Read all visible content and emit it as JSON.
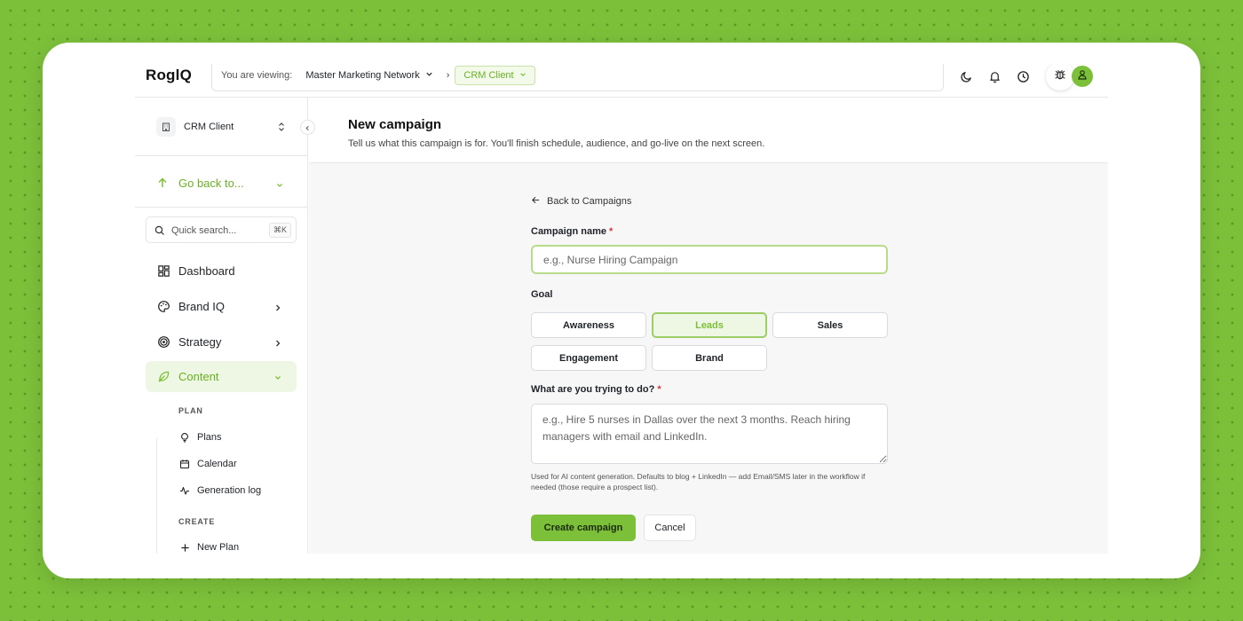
{
  "app": {
    "logo": "RoglQ",
    "viewing_label": "You are viewing:",
    "network": "Master Marketing Network",
    "breadcrumb_sep": "›",
    "client_pill": "CRM Client"
  },
  "header_icons": [
    "moon-icon",
    "bell-icon",
    "clock-icon",
    "bug-icon",
    "user-icon"
  ],
  "sidebar": {
    "client_name": "CRM Client",
    "go_back": "Go back to...",
    "search_placeholder": "Quick search...",
    "search_shortcut": "⌘K",
    "nav": [
      {
        "label": "Dashboard",
        "icon": "dashboard-icon"
      },
      {
        "label": "Brand IQ",
        "icon": "palette-icon"
      },
      {
        "label": "Strategy",
        "icon": "target-icon"
      },
      {
        "label": "Content",
        "icon": "leaf-icon"
      }
    ],
    "plan_label": "PLAN",
    "plan_items": [
      {
        "label": "Plans",
        "icon": "lightbulb-icon"
      },
      {
        "label": "Calendar",
        "icon": "calendar-icon"
      },
      {
        "label": "Generation log",
        "icon": "activity-icon"
      }
    ],
    "create_label": "CREATE",
    "create_items": [
      {
        "label": "New Plan",
        "icon": "plus-icon"
      }
    ]
  },
  "main": {
    "title": "New campaign",
    "subtitle": "Tell us what this campaign is for. You'll finish schedule, audience, and go-live on the next screen.",
    "back_link": "Back to Campaigns",
    "campaign_name_label": "Campaign name",
    "required_mark": "*",
    "campaign_name_placeholder": "e.g., Nurse Hiring Campaign",
    "campaign_name_value": "",
    "goal_label": "Goal",
    "goals": [
      "Awareness",
      "Leads",
      "Sales",
      "Engagement",
      "Brand"
    ],
    "selected_goal": "Leads",
    "objective_label": "What are you trying to do?",
    "objective_placeholder": "e.g., Hire 5 nurses in Dallas over the next 3 months. Reach hiring managers with email and LinkedIn.",
    "objective_value": "",
    "helper": "Used for AI content generation. Defaults to blog + LinkedIn — add Email/SMS later in the workflow if needed (those require a prospect list).",
    "create_button": "Create campaign",
    "cancel_button": "Cancel"
  },
  "colors": {
    "accent": "#7cc03a",
    "accent_text": "#6ab023",
    "background": "#7cc03a",
    "required": "#d23a3a"
  }
}
